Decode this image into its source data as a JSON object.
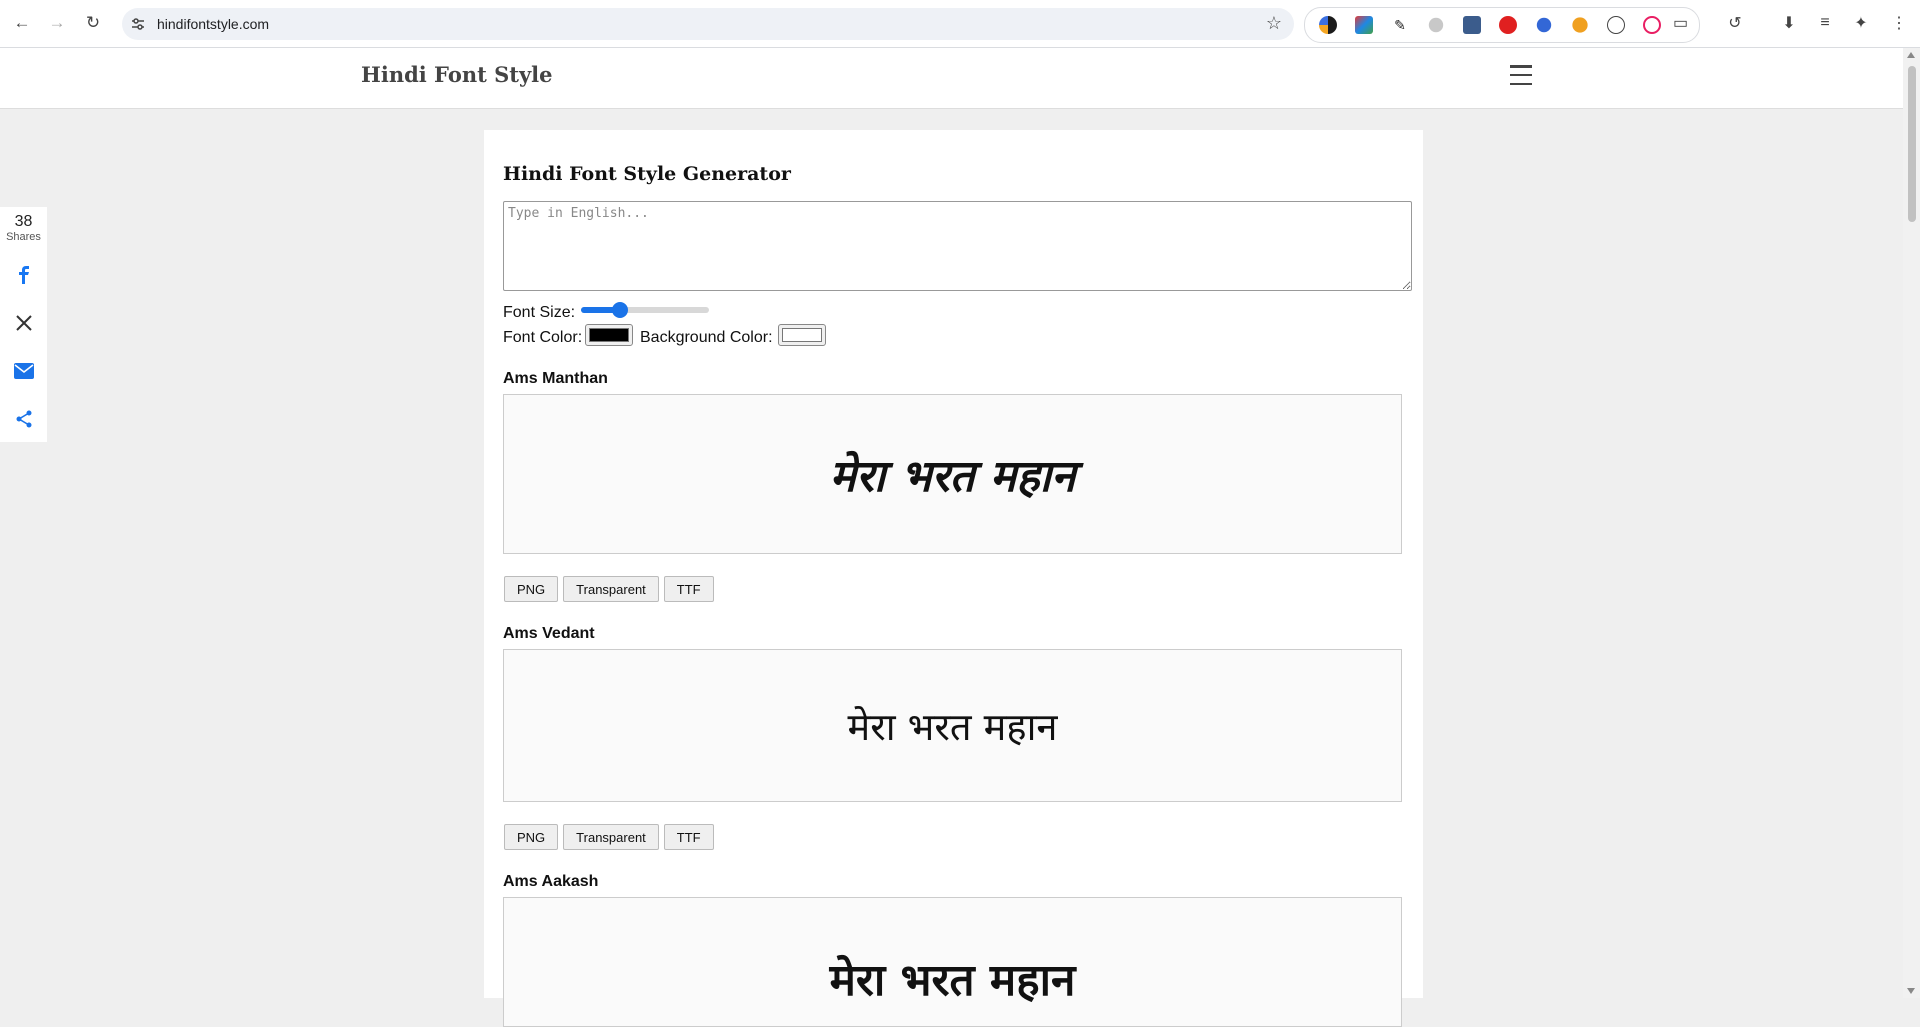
{
  "browser": {
    "url": "hindifontstyle.com"
  },
  "header": {
    "site_title": "Hindi Font Style"
  },
  "share": {
    "count": "38",
    "label": "Shares"
  },
  "generator": {
    "title": "Hindi Font Style Generator",
    "input_placeholder": "Type in English...",
    "font_size_label": "Font Size:",
    "font_size_level": 0.28,
    "font_color_label": "Font Color:",
    "font_color": "#000000",
    "bg_color_label": "Background Color:",
    "bg_color": "#ffffff"
  },
  "fonts": [
    {
      "name": "Ams Manthan",
      "sample": "मेरा भरत महान",
      "buttons": [
        "PNG",
        "Transparent",
        "TTF"
      ]
    },
    {
      "name": "Ams Vedant",
      "sample": "मेरा भरत महान",
      "buttons": [
        "PNG",
        "Transparent",
        "TTF"
      ]
    },
    {
      "name": "Ams Aakash",
      "sample": "मेरा भरत महान"
    }
  ]
}
